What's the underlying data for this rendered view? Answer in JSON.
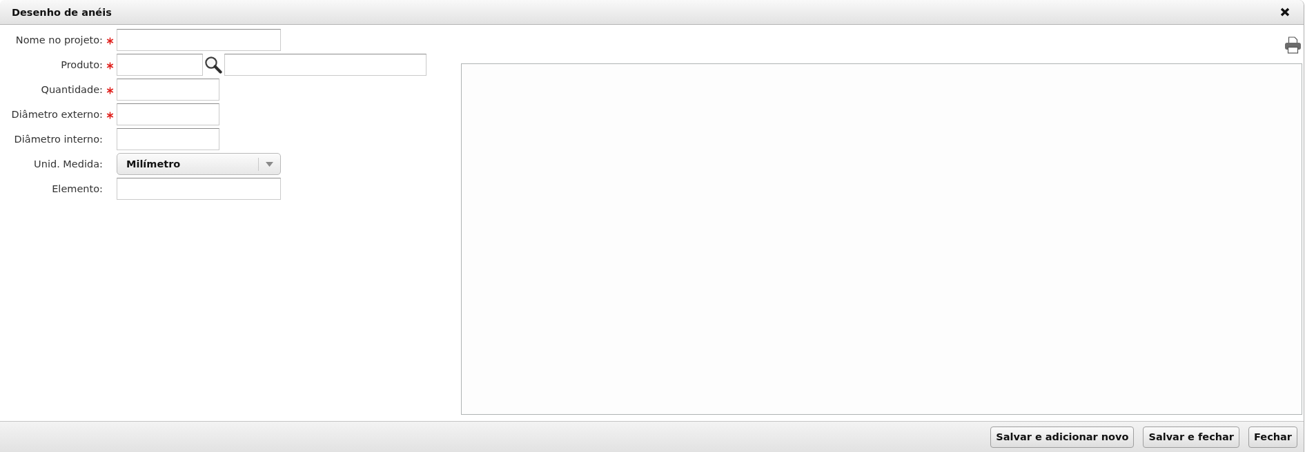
{
  "window": {
    "title": "Desenho de anéis"
  },
  "form": {
    "fields": [
      {
        "kind": "wide",
        "label": "Nome no projeto:",
        "required": true
      },
      {
        "kind": "lookup",
        "label": "Produto:",
        "required": true
      },
      {
        "kind": "short",
        "label": "Quantidade:",
        "required": true
      },
      {
        "kind": "short",
        "label": "Diâmetro externo:",
        "required": true
      },
      {
        "kind": "short",
        "label": "Diâmetro interno:",
        "required": false
      },
      {
        "kind": "select",
        "label": "Unid. Medida:",
        "required": false,
        "value": "Milímetro"
      },
      {
        "kind": "wide",
        "label": "Elemento:",
        "required": false
      }
    ]
  },
  "buttons": [
    "Salvar e adicionar novo",
    "Salvar e fechar",
    "Fechar"
  ]
}
